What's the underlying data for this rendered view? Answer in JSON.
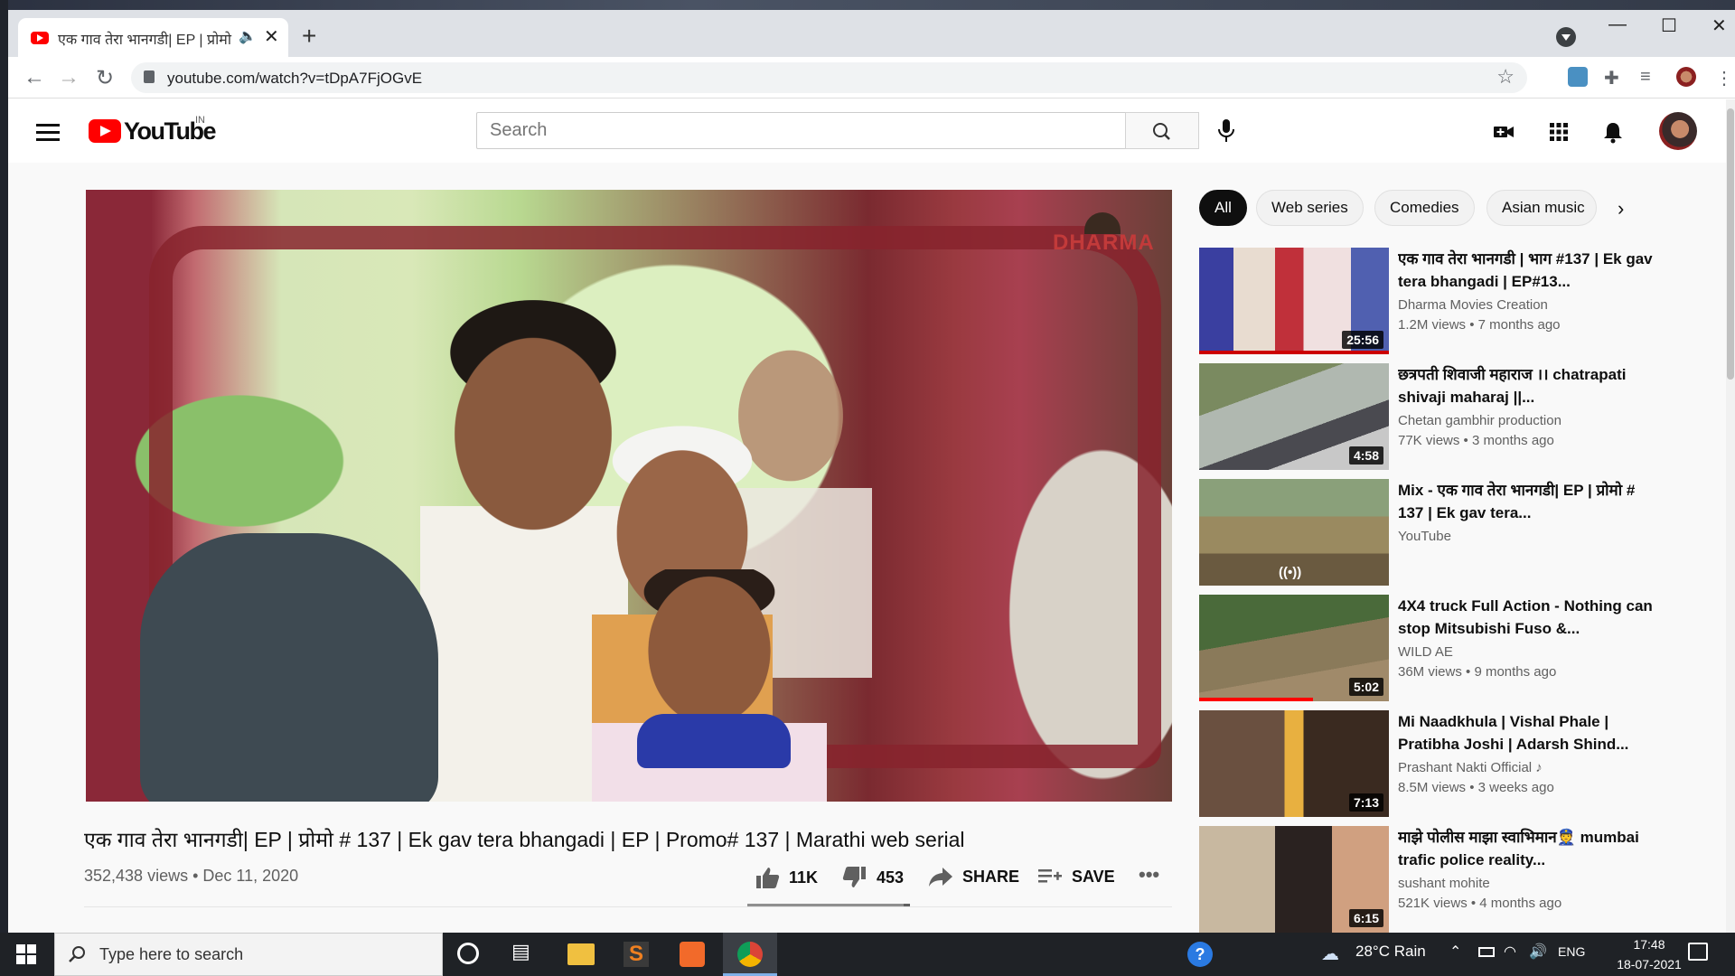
{
  "browser": {
    "tab_title": "एक गाव तेरा भानगडी| EP | प्रोमो",
    "url": "youtube.com/watch?v=tDpA7FjOGvE"
  },
  "youtube": {
    "logo_text": "YouTube",
    "country": "IN",
    "search_placeholder": "Search"
  },
  "video": {
    "title": "एक गाव तेरा भानगडी| EP | प्रोमो # 137 | Ek gav tera bhangadi | EP | Promo# 137 | Marathi web serial",
    "meta": "352,438 views • Dec 11, 2020",
    "likes": "11K",
    "dislikes": "453",
    "like_ratio": 0.96,
    "share_label": "SHARE",
    "save_label": "SAVE",
    "channel_watermark": "DHARMA"
  },
  "chips": [
    "All",
    "Web series",
    "Comedies",
    "Asian music"
  ],
  "recommendations": [
    {
      "title": "एक गाव तेरा भानगडी | भाग #137 | Ek gav tera bhangadi | EP#13...",
      "channel": "Dharma Movies Creation",
      "views": "1.2M views • 7 months ago",
      "duration": "25:56"
    },
    {
      "title": "छत्रपती शिवाजी महाराज ।। chatrapati shivaji maharaj ||...",
      "channel": "Chetan gambhir production",
      "views": "77K views • 3 months ago",
      "duration": "4:58"
    },
    {
      "title": "Mix - एक गाव तेरा भानगडी| EP | प्रोमो # 137 | Ek gav tera...",
      "channel": "YouTube",
      "views": "",
      "duration": ""
    },
    {
      "title": "4X4 truck Full Action - Nothing can stop Mitsubishi Fuso &...",
      "channel": "WILD AE",
      "views": "36M views • 9 months ago",
      "duration": "5:02",
      "watched": 0.6
    },
    {
      "title": "Mi Naadkhula | Vishal Phale | Pratibha Joshi | Adarsh Shind...",
      "channel": "Prashant Nakti Official ♪",
      "views": "8.5M views • 3 weeks ago",
      "duration": "7:13"
    },
    {
      "title": "माझे पोलीस माझा स्वाभिमान👮 mumbai trafic police reality...",
      "channel": "sushant mohite",
      "views": "521K views • 4 months ago",
      "duration": "6:15"
    }
  ],
  "taskbar": {
    "search_placeholder": "Type here to search",
    "weather": "28°C  Rain",
    "language": "ENG",
    "time": "17:48",
    "date": "18-07-2021"
  }
}
